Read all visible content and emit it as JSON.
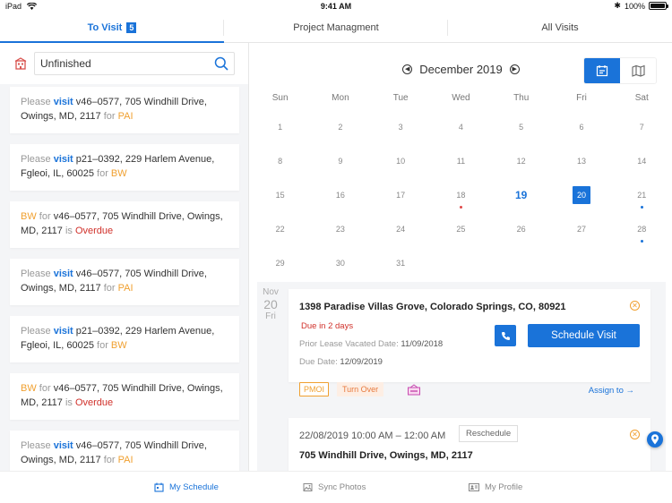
{
  "status_bar": {
    "device": "iPad",
    "time": "9:41 AM",
    "battery": "100%"
  },
  "tabs": [
    {
      "label": "To Visit",
      "badge": "5",
      "active": true
    },
    {
      "label": "Project Managment",
      "active": false
    },
    {
      "label": "All Visits",
      "active": false
    }
  ],
  "filter": {
    "value": "Unfinished"
  },
  "cards": [
    {
      "type": "visit",
      "prefix": "Please",
      "action": "visit",
      "text": "v46–0577, 705 Windhill Drive, Owings, MD, 2117",
      "for": "for",
      "assignee": "PAI"
    },
    {
      "type": "visit",
      "prefix": "Please",
      "action": "visit",
      "text": "p21–0392, 229 Harlem Avenue, Fgleoi, IL, 60025",
      "for": "for",
      "assignee": "BW"
    },
    {
      "type": "overdue",
      "assignee": "BW",
      "for": "for",
      "text": "v46–0577, 705 Windhill Drive, Owings, MD, 2117",
      "is": "is",
      "status": "Overdue"
    },
    {
      "type": "visit",
      "prefix": "Please",
      "action": "visit",
      "text": "v46–0577, 705 Windhill Drive, Owings, MD, 2117",
      "for": "for",
      "assignee": "PAI"
    },
    {
      "type": "visit",
      "prefix": "Please",
      "action": "visit",
      "text": "p21–0392, 229 Harlem Avenue, Fgleoi, IL, 60025",
      "for": "for",
      "assignee": "BW"
    },
    {
      "type": "overdue",
      "assignee": "BW",
      "for": "for",
      "text": "v46–0577, 705 Windhill Drive, Owings, MD, 2117",
      "is": "is",
      "status": "Overdue"
    },
    {
      "type": "visit",
      "prefix": "Please",
      "action": "visit",
      "text": "v46–0577, 705 Windhill Drive, Owings, MD, 2117",
      "for": "for",
      "assignee": "PAI"
    }
  ],
  "calendar": {
    "month_label": "December 2019",
    "weekdays": [
      "Sun",
      "Mon",
      "Tue",
      "Wed",
      "Thu",
      "Fri",
      "Sat"
    ],
    "weeks": [
      [
        "1",
        "2",
        "3",
        "4",
        "5",
        "6",
        "7"
      ],
      [
        "8",
        "9",
        "10",
        "11",
        "12",
        "13",
        "14"
      ],
      [
        "15",
        "16",
        "17",
        "18",
        "19",
        "20",
        "21"
      ],
      [
        "22",
        "23",
        "24",
        "25",
        "26",
        "27",
        "28"
      ],
      [
        "29",
        "30",
        "31",
        "",
        "",
        "",
        ""
      ]
    ],
    "today": "19",
    "selected": "20",
    "dots": {
      "18": "#e04848",
      "21": "#1a73d9",
      "28": "#1a73d9"
    },
    "accent": "#1a73d9"
  },
  "schedule": {
    "date": {
      "month": "Nov",
      "day": "20",
      "weekday": "Fri"
    },
    "visit1": {
      "address": "1398 Paradise Villas Grove, Colorado Springs, CO, 80921",
      "due_in": "Due in 2 days",
      "lease_label": "Prior Lease Vacated Date:",
      "lease_value": "11/09/2018",
      "due_label": "Due Date:",
      "due_value": "12/09/2019",
      "button": "Schedule Visit",
      "tag_pmoi": "PMOI",
      "tag_turn": "Turn Over",
      "assign": "Assign to →"
    },
    "visit2": {
      "time": "22/08/2019 10:00 AM – 12:00 AM",
      "reschedule": "Reschedule",
      "address": "705 Windhill Drive, Owings, MD, 2117"
    }
  },
  "bottom_nav": [
    {
      "label": "My Schedule",
      "icon": "calendar-icon",
      "active": true
    },
    {
      "label": "Sync Photos",
      "icon": "photo-icon",
      "active": false
    },
    {
      "label": "My Profile",
      "icon": "profile-card-icon",
      "active": false
    }
  ]
}
